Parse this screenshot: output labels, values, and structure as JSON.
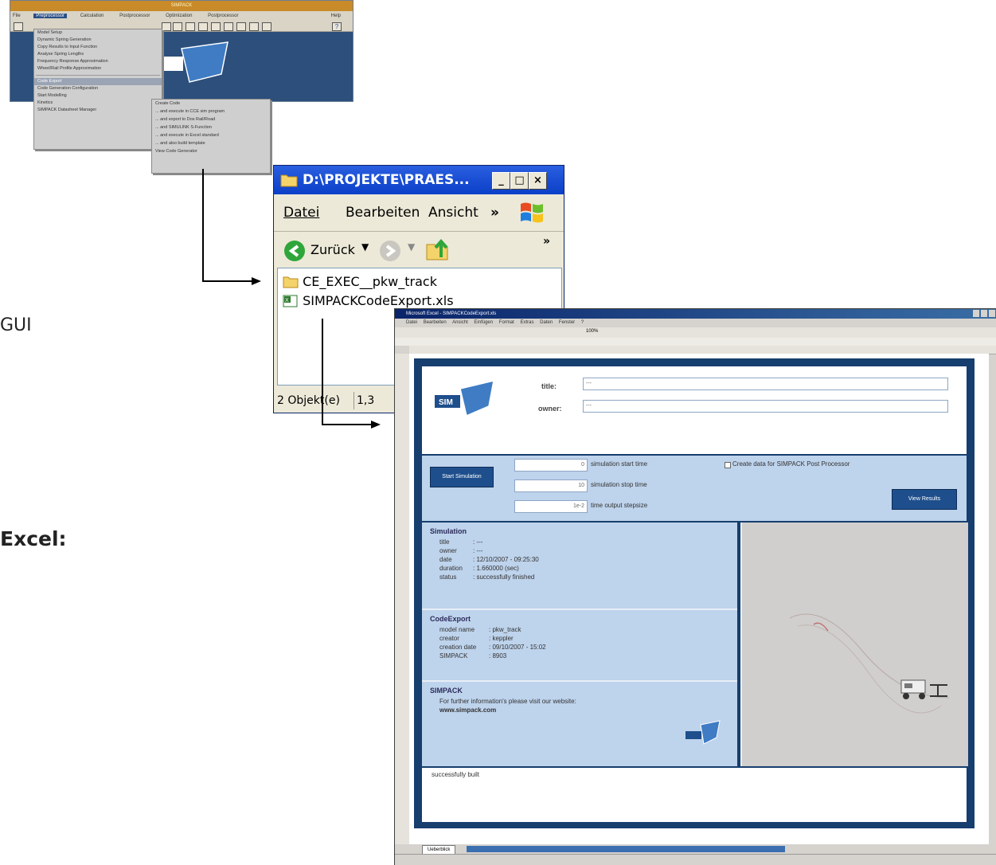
{
  "side_labels": {
    "gui": "GUI",
    "excel": "Excel:"
  },
  "simpack_gui": {
    "menus": [
      "File",
      "Preprocessor",
      "Calculation",
      "Postprocessor",
      "Optimization",
      "Postprocessor",
      "Help"
    ],
    "active_menu": "Preprocessor",
    "menu_items": [
      "Model Setup",
      "Dynamic Spring Generation",
      "Copy Results to Input Function",
      "Analyse Spring Lengths",
      "Frequency Response Approximation",
      "Wheel/Rail Profile Approximation",
      "",
      "Code Export",
      "Code Generation Configuration",
      "Start Modelling",
      "Kinetics",
      "SIMPACK Datasheet Manager"
    ],
    "highlighted_item": "Code Export",
    "submenu_items": [
      "Create Code",
      "... and execute in CCE sim program",
      "... and export to Dos Rail/Road",
      "... and SIMULINK S-Function",
      "... and execute in Excel standard",
      "... and also build template",
      "View Code Generator"
    ]
  },
  "explorer": {
    "title": "D:\\PROJEKTE\\PRAES...",
    "menu": {
      "file": "Datei",
      "edit": "Bearbeiten",
      "view": "Ansicht",
      "more": "»"
    },
    "toolbar": {
      "back": "Zurück",
      "more": "»"
    },
    "items": [
      {
        "name": "CE_EXEC__pkw_track",
        "icon": "folder-icon"
      },
      {
        "name": "SIMPACKCodeExport.xls",
        "icon": "excel-file-icon"
      }
    ],
    "status": {
      "count": "2 Objekt(e)",
      "size": "1,3"
    }
  },
  "excel": {
    "title": "Microsoft Excel - SIMPACKCodeExport.xls",
    "menus": [
      "Datei",
      "Bearbeiten",
      "Ansicht",
      "Einfügen",
      "Format",
      "Extras",
      "Daten",
      "Fenster",
      "?"
    ],
    "zoom": "100%",
    "sheet_tab": "Ueberblick",
    "header": {
      "title_label": "title:",
      "title_value": "---",
      "owner_label": "owner:",
      "owner_value": "---"
    },
    "simulation": {
      "start_button": "Start Simulation",
      "start_time": "0",
      "start_time_label": "simulation start time",
      "stop_time": "10",
      "stop_time_label": "simulation stop time",
      "step_size": "1e-2",
      "step_size_label": "time output stepsize",
      "postproc_label": "Create data for SIMPACK Post Processor",
      "view_button": "View Results"
    },
    "simulation_info": {
      "heading": "Simulation",
      "rows": [
        {
          "k": "title",
          "v": ": ---"
        },
        {
          "k": "owner",
          "v": ": ---"
        },
        {
          "k": "date",
          "v": ": 12/10/2007 - 09:25:30"
        },
        {
          "k": "duration",
          "v": ": 1.660000   (sec)"
        },
        {
          "k": "status",
          "v": ": successfully finished"
        }
      ]
    },
    "codeexport_info": {
      "heading": "CodeExport",
      "rows": [
        {
          "k": "model name",
          "v": ": pkw_track"
        },
        {
          "k": "creator",
          "v": ": keppler"
        },
        {
          "k": "creation date",
          "v": ": 09/10/2007 - 15:02"
        },
        {
          "k": "SIMPACK",
          "v": ": 8903"
        }
      ]
    },
    "simpack_info": {
      "heading": "SIMPACK",
      "text": "For further information's please visit our website:",
      "website": "www.simpack.com"
    },
    "logo_text": "SIM",
    "bottom_text": "successfully built"
  }
}
